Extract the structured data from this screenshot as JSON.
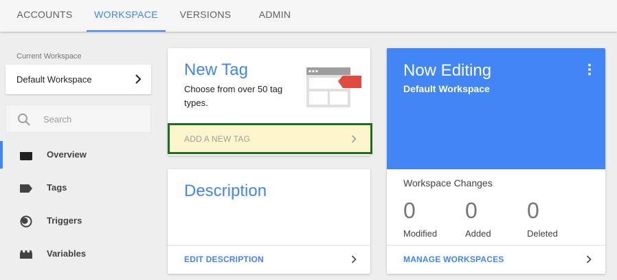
{
  "tabs": [
    {
      "label": "ACCOUNTS"
    },
    {
      "label": "WORKSPACE"
    },
    {
      "label": "VERSIONS"
    },
    {
      "label": "ADMIN"
    }
  ],
  "sidebar": {
    "workspace_label": "Current Workspace",
    "workspace_name": "Default Workspace",
    "search_placeholder": "Search",
    "items": [
      {
        "label": "Overview",
        "icon": "overview-icon"
      },
      {
        "label": "Tags",
        "icon": "tag-icon"
      },
      {
        "label": "Triggers",
        "icon": "trigger-icon"
      },
      {
        "label": "Variables",
        "icon": "variables-icon"
      }
    ]
  },
  "new_tag_card": {
    "title": "New Tag",
    "description": "Choose from over 50 tag types.",
    "action": "ADD A NEW TAG"
  },
  "description_card": {
    "title": "Description",
    "action": "EDIT DESCRIPTION"
  },
  "editing_card": {
    "title": "Now Editing",
    "workspace": "Default Workspace",
    "changes_label": "Workspace Changes",
    "stats": [
      {
        "value": "0",
        "label": "Modified"
      },
      {
        "value": "0",
        "label": "Added"
      },
      {
        "value": "0",
        "label": "Deleted"
      }
    ],
    "action": "MANAGE WORKSPACES"
  },
  "colors": {
    "accent": "#4285f4",
    "highlight_border": "#1b6e1b",
    "highlight_fill": "#fdf6cc",
    "tag_red": "#e04b3f"
  }
}
